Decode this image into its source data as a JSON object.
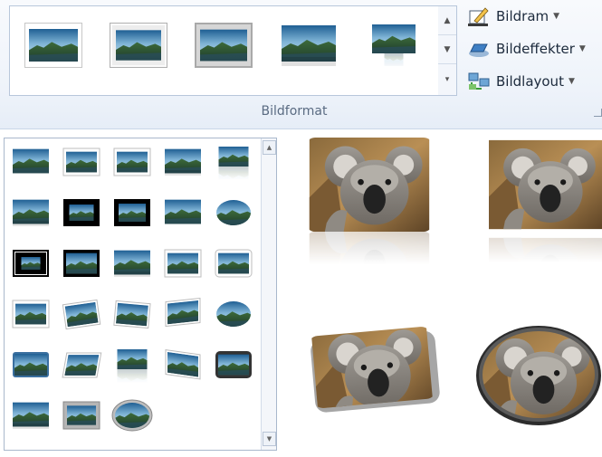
{
  "ribbon": {
    "group_label": "Bildformat",
    "commands": [
      {
        "label": "Bildram",
        "icon": "picture-border-icon"
      },
      {
        "label": "Bildeffekter",
        "icon": "picture-effects-icon"
      },
      {
        "label": "Bildlayout",
        "icon": "picture-layout-icon"
      }
    ],
    "gallery_styles": [
      "simple-frame-white",
      "beveled-matte-white",
      "metal-frame",
      "soft-edge",
      "reflected-rounded"
    ],
    "scroll_icons": [
      "scroll-up-icon",
      "scroll-down-icon",
      "expand-gallery-icon"
    ]
  },
  "dropdown": {
    "style_count": 28,
    "columns": 5
  },
  "previews": [
    {
      "style": "reflected-rounded-rectangle"
    },
    {
      "style": "reflected-soft-edge"
    },
    {
      "style": "rotated-rounded-shadow"
    },
    {
      "style": "oval-metal-frame"
    }
  ],
  "colors": {
    "ribbon_bg": "#eef3fa",
    "border": "#b8c7db",
    "label": "#5a6b82",
    "text": "#1c2a3c"
  }
}
